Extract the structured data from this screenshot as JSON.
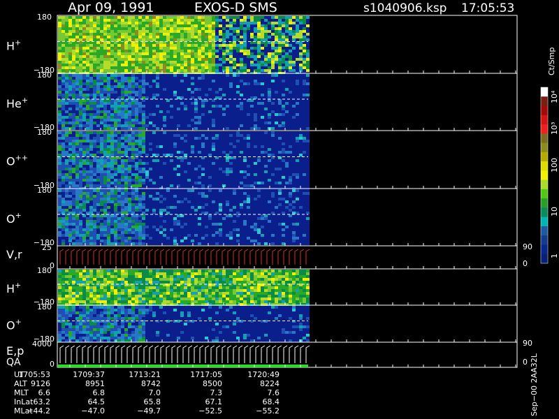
{
  "header": {
    "date": "Apr 09, 1991",
    "instrument": "EXOS-D SMS",
    "file": "s1040906.ksp",
    "time": "17:05:53"
  },
  "colorbar": {
    "unit": "Ct/Smp",
    "labels": [
      "10⁴",
      "10³",
      "100",
      "10",
      "1"
    ],
    "colors": [
      "#ffffff",
      "#7a1f14",
      "#a50a0a",
      "#d21414",
      "#f01e1e",
      "#7c6a1e",
      "#8c8c1e",
      "#b4aa00",
      "#dcdc00",
      "#f0f000",
      "#a8dc28",
      "#50c814",
      "#28a028",
      "#0a8c5a",
      "#00b4b4",
      "#1e5aa0",
      "#143c8c",
      "#0a288c",
      "#082078"
    ]
  },
  "panels": [
    {
      "label": "H",
      "sup": "+",
      "top_tick": "180",
      "bottom_tick": "−180",
      "right_top": "",
      "right_bottom": ""
    },
    {
      "label": "He",
      "sup": "+",
      "top_tick": "180",
      "bottom_tick": "−180",
      "right_top": "",
      "right_bottom": ""
    },
    {
      "label": "O",
      "sup": "++",
      "top_tick": "180",
      "bottom_tick": "−180",
      "right_top": "",
      "right_bottom": ""
    },
    {
      "label": "O",
      "sup": "+",
      "top_tick": "180",
      "bottom_tick": "−180",
      "right_top": "",
      "right_bottom": ""
    },
    {
      "label": "V,r",
      "sup": "",
      "top_tick": "25",
      "bottom_tick": "0",
      "right_top": "90",
      "right_bottom": "0"
    },
    {
      "label": "H",
      "sup": "+",
      "top_tick": "180",
      "bottom_tick": "−180",
      "right_top": "",
      "right_bottom": ""
    },
    {
      "label": "O",
      "sup": "+",
      "top_tick": "180",
      "bottom_tick": "−180",
      "right_top": "",
      "right_bottom": ""
    },
    {
      "label": "E,p",
      "label2": "QA",
      "sup": "",
      "top_tick": "4000",
      "bottom_tick": "0",
      "right_top": "90",
      "right_bottom": "0"
    }
  ],
  "ephemeris": {
    "rows": [
      {
        "name": "UT",
        "values": [
          "1705:53",
          "1709:37",
          "1713:21",
          "1717:05",
          "1720:49"
        ]
      },
      {
        "name": "ALT",
        "values": [
          "9126",
          "8951",
          "8742",
          "8500",
          "8224"
        ]
      },
      {
        "name": "MLT",
        "values": [
          "6.6",
          "6.8",
          "7.0",
          "7.3",
          "7.6"
        ]
      },
      {
        "name": "InLat",
        "values": [
          "63.2",
          "64.5",
          "65.8",
          "67.1",
          "68.4"
        ]
      },
      {
        "name": "MLat",
        "values": [
          "−44.2",
          "−47.0",
          "−49.7",
          "−52.5",
          "−55.2"
        ]
      }
    ]
  },
  "footer_vertical": "Sep−00 2AA32L",
  "chart_data": {
    "type": "heatmap",
    "title": "Apr 09, 1991    EXOS-D SMS",
    "xlabel": "UT",
    "x_ticks": [
      "1705:53",
      "1709:37",
      "1713:21",
      "1717:05",
      "1720:49"
    ],
    "ylim_angle": [
      -180,
      180
    ],
    "colorbar_unit": "Ct/Smp",
    "colorbar_ticks": [
      1,
      10,
      100,
      1000,
      10000
    ],
    "panels": [
      "H+",
      "He+",
      "O++",
      "O+",
      "V,r",
      "H+",
      "O+",
      "E,p / QA"
    ],
    "data_extent_fraction": 0.55
  }
}
